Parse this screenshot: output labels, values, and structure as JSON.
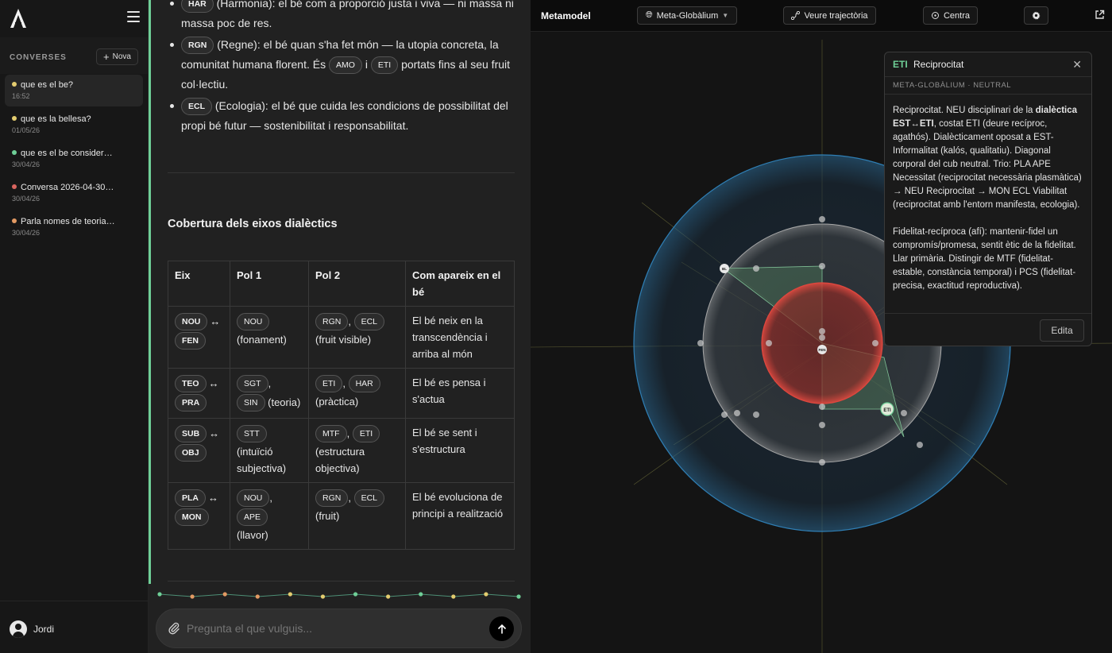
{
  "sidebar": {
    "section_label": "CONVERSES",
    "new_button": "Nova",
    "conversations": [
      {
        "title": "que es el be?",
        "date": "16:52",
        "dot_color": "#e3cc6f",
        "active": true
      },
      {
        "title": "que es la bellesa?",
        "date": "01/05/26",
        "dot_color": "#e3cc6f"
      },
      {
        "title": "que es el be consider…",
        "date": "30/04/26",
        "dot_color": "#6fcf97"
      },
      {
        "title": "Conversa 2026-04-30…",
        "date": "30/04/26",
        "dot_color": "#d9655f"
      },
      {
        "title": "Parla nomes de teoria…",
        "date": "30/04/26",
        "dot_color": "#e39a63"
      }
    ],
    "user": "Jordi"
  },
  "chat": {
    "bullets": [
      {
        "chip": "HAR",
        "text": "(Harmonia): el bé com a proporció justa i viva — ni massa ni massa poc de res."
      },
      {
        "chip": "RGN",
        "text_a": "(Regne): el bé quan s'ha fet món — la utopia concreta, la comunitat humana florent. És",
        "chip_b": "AMO",
        "text_b": "i",
        "chip_c": "ETI",
        "text_c": "portats fins al seu fruit col·lectiu."
      },
      {
        "chip": "ECL",
        "text": "(Ecologia): el bé que cuida les condicions de possibilitat del propi bé futur — sostenibilitat i responsabilitat."
      }
    ],
    "section_title": "Cobertura dels eixos dialèctics",
    "table": {
      "headers": [
        "Eix",
        "Pol 1",
        "Pol 2",
        "Com apareix en el bé"
      ],
      "rows": [
        {
          "axis": [
            "NOU",
            "FEN"
          ],
          "pol1_chips": [
            "NOU"
          ],
          "pol1_note": "(fonament)",
          "pol2_chips": [
            "RGN",
            "ECL"
          ],
          "pol2_note": "(fruit visible)",
          "desc": "El bé neix en la transcendència i arriba al món"
        },
        {
          "axis": [
            "TEO",
            "PRA"
          ],
          "pol1_chips": [
            "SGT",
            "SIN"
          ],
          "pol1_note": "(teoria)",
          "pol2_chips": [
            "ETI",
            "HAR"
          ],
          "pol2_note": "(pràctica)",
          "desc": "El bé es pensa i s'actua"
        },
        {
          "axis": [
            "SUB",
            "OBJ"
          ],
          "pol1_chips": [
            "STT"
          ],
          "pol1_note": "(intuïció subjectiva)",
          "pol2_chips": [
            "MTF",
            "ETI"
          ],
          "pol2_note": "(estructura objectiva)",
          "desc": "El bé se sent i s'estructura"
        },
        {
          "axis": [
            "PLA",
            "MON"
          ],
          "pol1_chips": [
            "NOU",
            "APE"
          ],
          "pol1_note": "(llavor)",
          "pol2_chips": [
            "RGN",
            "ECL"
          ],
          "pol2_note": "(fruit)",
          "desc": "El bé evoluciona de principi a realització"
        }
      ]
    },
    "timeline_dots": [
      "#6fcf97",
      "#e39a63",
      "#e39a63",
      "#e39a63",
      "#e3cc6f",
      "#e3cc6f",
      "#6fcf97",
      "#e3cc6f",
      "#6fcf97",
      "#e3cc6f",
      "#e3cc6f",
      "#6fcf97"
    ],
    "composer_placeholder": "Pregunta el que vulguis..."
  },
  "metamodel": {
    "title": "Metamodel",
    "selector": "Meta-Globàlium",
    "trajectory_button": "Veure trajectòria",
    "center_button": "Centra",
    "panel": {
      "code": "ETI",
      "title": "Reciprocitat",
      "subtitle": "META-GLOBÀLIUM · NEUTRAL",
      "para1_a": "Reciprocitat. NEU disciplinari de la ",
      "para1_bold": "dialèctica EST↔ETI",
      "para1_b": ", costat ETI (deure recíproc, agathós). Dialècticament oposat a EST-Informalitat (kalós, qualitatiu). Diagonal corporal del cub neutral. Trio: PLA APE Necessitat (reciprocitat necessària plasmàtica) → NEU Reciprocitat → MON ECL Viabilitat (reciprocitat amb l'entorn manifesta, ecologia).",
      "para2": "Fidelitat-recíproca (afí): mantenir-fidel un compromís/promesa, sentit ètic de la fidelitat. Llar primària. Distingir de MTF (fidelitat-estable, constància temporal) i PCS (fidelitat-precisa, exactitud reproductiva).",
      "edit_button": "Edita"
    },
    "nodes": {
      "eti": "ETI",
      "fen": "FEN",
      "bl": "BL"
    },
    "colors": {
      "accent": "#6fcf97",
      "sphere_red": "#d0453c",
      "sphere_blue": "#2a5e86"
    }
  }
}
